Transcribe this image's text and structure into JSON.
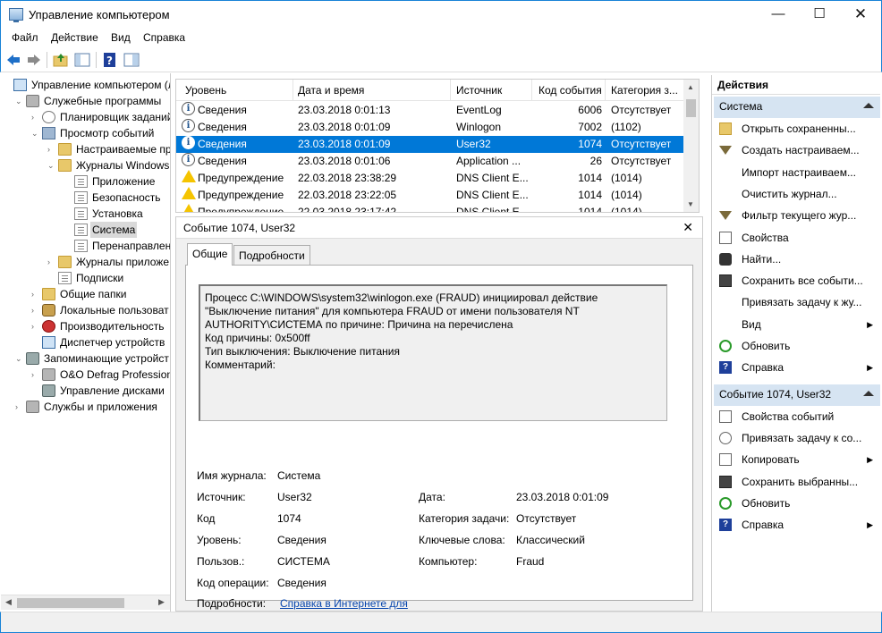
{
  "window": {
    "title": "Управление компьютером",
    "min": "—",
    "max": "☐",
    "close": "✕"
  },
  "menu": [
    "Файл",
    "Действие",
    "Вид",
    "Справка"
  ],
  "toolbar_icons": [
    "back-icon",
    "forward-icon",
    "up-folder-icon",
    "show-hide-tree-icon",
    "help-icon",
    "show-action-pane-icon"
  ],
  "tree": [
    {
      "label": "Управление компьютером (л",
      "icon": "computer-icon",
      "expander": "",
      "level": 0
    },
    {
      "label": "Служебные программы",
      "icon": "tools-icon",
      "expander": "⌄",
      "level": 1
    },
    {
      "label": "Планировщик заданий",
      "icon": "clock-icon",
      "expander": "›",
      "level": 2
    },
    {
      "label": "Просмотр событий",
      "icon": "event-viewer-icon",
      "expander": "⌄",
      "level": 2
    },
    {
      "label": "Настраиваемые пр",
      "icon": "folder-icon",
      "expander": "›",
      "level": 3
    },
    {
      "label": "Журналы Windows",
      "icon": "folder-icon",
      "expander": "⌄",
      "level": 3
    },
    {
      "label": "Приложение",
      "icon": "log-icon",
      "expander": "",
      "level": 4
    },
    {
      "label": "Безопасность",
      "icon": "log-icon",
      "expander": "",
      "level": 4
    },
    {
      "label": "Установка",
      "icon": "log-icon",
      "expander": "",
      "level": 4
    },
    {
      "label": "Система",
      "icon": "log-icon",
      "expander": "",
      "level": 4,
      "selected": true
    },
    {
      "label": "Перенаправлен",
      "icon": "log-icon",
      "expander": "",
      "level": 4
    },
    {
      "label": "Журналы приложе",
      "icon": "folder-icon",
      "expander": "›",
      "level": 3
    },
    {
      "label": "Подписки",
      "icon": "log-icon",
      "expander": "",
      "level": 3
    },
    {
      "label": "Общие папки",
      "icon": "shared-folders-icon",
      "expander": "›",
      "level": 2
    },
    {
      "label": "Локальные пользоват",
      "icon": "users-icon",
      "expander": "›",
      "level": 2
    },
    {
      "label": "Производительность",
      "icon": "performance-icon",
      "expander": "›",
      "level": 2
    },
    {
      "label": "Диспетчер устройств",
      "icon": "device-manager-icon",
      "expander": "",
      "level": 2
    },
    {
      "label": "Запоминающие устройст",
      "icon": "storage-icon",
      "expander": "⌄",
      "level": 1
    },
    {
      "label": "O&O Defrag Profession",
      "icon": "defrag-icon",
      "expander": "›",
      "level": 2
    },
    {
      "label": "Управление дисками",
      "icon": "disk-icon",
      "expander": "",
      "level": 2
    },
    {
      "label": "Службы и приложения",
      "icon": "services-icon",
      "expander": "›",
      "level": 1
    }
  ],
  "events": {
    "columns": [
      "Уровень",
      "Дата и время",
      "Источник",
      "Код события",
      "Категория з..."
    ],
    "rows": [
      {
        "level": "Сведения",
        "type": "info",
        "date": "23.03.2018 0:01:13",
        "source": "EventLog",
        "code": "6006",
        "cat": "Отсутствует"
      },
      {
        "level": "Сведения",
        "type": "info",
        "date": "23.03.2018 0:01:09",
        "source": "Winlogon",
        "code": "7002",
        "cat": "(1102)"
      },
      {
        "level": "Сведения",
        "type": "info",
        "date": "23.03.2018 0:01:09",
        "source": "User32",
        "code": "1074",
        "cat": "Отсутствует",
        "selected": true
      },
      {
        "level": "Сведения",
        "type": "info",
        "date": "23.03.2018 0:01:06",
        "source": "Application ...",
        "code": "26",
        "cat": "Отсутствует"
      },
      {
        "level": "Предупреждение",
        "type": "warn",
        "date": "22.03.2018 23:38:29",
        "source": "DNS Client E...",
        "code": "1014",
        "cat": "(1014)"
      },
      {
        "level": "Предупреждение",
        "type": "warn",
        "date": "22.03.2018 23:22:05",
        "source": "DNS Client E...",
        "code": "1014",
        "cat": "(1014)"
      },
      {
        "level": "Предупреждение",
        "type": "warn",
        "date": "22.03.2018 23:17:42",
        "source": "DNS Client E...",
        "code": "1014",
        "cat": "(1014)"
      }
    ]
  },
  "detail": {
    "title": "Событие 1074, User32",
    "close": "✕",
    "tabs": [
      "Общие",
      "Подробности"
    ],
    "description": "Процесс C:\\WINDOWS\\system32\\winlogon.exe (FRAUD) инициировал действие \"Выключение питания\" для компьютера FRAUD от имени пользователя NT AUTHORITY\\СИСТЕМА по причине: Причина на перечислена\nКод причины: 0x500ff\nТип выключения: Выключение питания\nКомментарий:",
    "fields": {
      "log_name_label": "Имя журнала:",
      "log_name": "Система",
      "source_label": "Источник:",
      "source": "User32",
      "date_label": "Дата:",
      "date": "23.03.2018 0:01:09",
      "code_label": "Код",
      "code": "1074",
      "task_label": "Категория задачи:",
      "task": "Отсутствует",
      "level_label": "Уровень:",
      "level": "Сведения",
      "keywords_label": "Ключевые слова:",
      "keywords": "Классический",
      "user_label": "Пользов.:",
      "user": "СИСТЕМА",
      "computer_label": "Компьютер:",
      "computer": "Fraud",
      "opcode_label": "Код операции:",
      "opcode": "Сведения",
      "more_label": "Подробности:",
      "more_link": "Справка в Интернете для"
    }
  },
  "actions": {
    "title": "Действия",
    "section1": "Система",
    "items1": [
      {
        "label": "Открыть сохраненны...",
        "icon": "open-folder-icon",
        "sub": ""
      },
      {
        "label": "Создать настраиваем...",
        "icon": "filter-icon",
        "sub": ""
      },
      {
        "label": "Импорт настраиваем...",
        "icon": "",
        "sub": ""
      },
      {
        "label": "Очистить журнал...",
        "icon": "",
        "sub": ""
      },
      {
        "label": "Фильтр текущего жур...",
        "icon": "filter-icon",
        "sub": ""
      },
      {
        "label": "Свойства",
        "icon": "properties-icon",
        "sub": ""
      },
      {
        "label": "Найти...",
        "icon": "binoculars-icon",
        "sub": ""
      },
      {
        "label": "Сохранить все событи...",
        "icon": "save-icon",
        "sub": ""
      },
      {
        "label": "Привязать задачу к жу...",
        "icon": "",
        "sub": ""
      },
      {
        "label": "Вид",
        "icon": "",
        "sub": "▶"
      },
      {
        "label": "Обновить",
        "icon": "refresh-icon",
        "sub": ""
      },
      {
        "label": "Справка",
        "icon": "help-icon",
        "sub": "▶"
      }
    ],
    "section2": "Событие 1074, User32",
    "items2": [
      {
        "label": "Свойства событий",
        "icon": "properties-icon",
        "sub": ""
      },
      {
        "label": "Привязать задачу к со...",
        "icon": "task-icon",
        "sub": ""
      },
      {
        "label": "Копировать",
        "icon": "copy-icon",
        "sub": "▶"
      },
      {
        "label": "Сохранить выбранны...",
        "icon": "save-icon",
        "sub": ""
      },
      {
        "label": "Обновить",
        "icon": "refresh-icon",
        "sub": ""
      },
      {
        "label": "Справка",
        "icon": "help-icon",
        "sub": "▶"
      }
    ]
  }
}
